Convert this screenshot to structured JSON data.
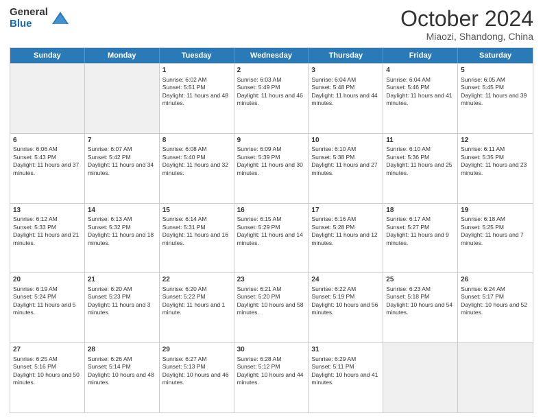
{
  "header": {
    "logo": {
      "general": "General",
      "blue": "Blue"
    },
    "title": "October 2024",
    "subtitle": "Miaozi, Shandong, China"
  },
  "weekdays": [
    "Sunday",
    "Monday",
    "Tuesday",
    "Wednesday",
    "Thursday",
    "Friday",
    "Saturday"
  ],
  "weeks": [
    [
      {
        "day": "",
        "empty": true
      },
      {
        "day": "",
        "empty": true
      },
      {
        "day": "1",
        "sunrise": "Sunrise: 6:02 AM",
        "sunset": "Sunset: 5:51 PM",
        "daylight": "Daylight: 11 hours and 48 minutes."
      },
      {
        "day": "2",
        "sunrise": "Sunrise: 6:03 AM",
        "sunset": "Sunset: 5:49 PM",
        "daylight": "Daylight: 11 hours and 46 minutes."
      },
      {
        "day": "3",
        "sunrise": "Sunrise: 6:04 AM",
        "sunset": "Sunset: 5:48 PM",
        "daylight": "Daylight: 11 hours and 44 minutes."
      },
      {
        "day": "4",
        "sunrise": "Sunrise: 6:04 AM",
        "sunset": "Sunset: 5:46 PM",
        "daylight": "Daylight: 11 hours and 41 minutes."
      },
      {
        "day": "5",
        "sunrise": "Sunrise: 6:05 AM",
        "sunset": "Sunset: 5:45 PM",
        "daylight": "Daylight: 11 hours and 39 minutes."
      }
    ],
    [
      {
        "day": "6",
        "sunrise": "Sunrise: 6:06 AM",
        "sunset": "Sunset: 5:43 PM",
        "daylight": "Daylight: 11 hours and 37 minutes."
      },
      {
        "day": "7",
        "sunrise": "Sunrise: 6:07 AM",
        "sunset": "Sunset: 5:42 PM",
        "daylight": "Daylight: 11 hours and 34 minutes."
      },
      {
        "day": "8",
        "sunrise": "Sunrise: 6:08 AM",
        "sunset": "Sunset: 5:40 PM",
        "daylight": "Daylight: 11 hours and 32 minutes."
      },
      {
        "day": "9",
        "sunrise": "Sunrise: 6:09 AM",
        "sunset": "Sunset: 5:39 PM",
        "daylight": "Daylight: 11 hours and 30 minutes."
      },
      {
        "day": "10",
        "sunrise": "Sunrise: 6:10 AM",
        "sunset": "Sunset: 5:38 PM",
        "daylight": "Daylight: 11 hours and 27 minutes."
      },
      {
        "day": "11",
        "sunrise": "Sunrise: 6:10 AM",
        "sunset": "Sunset: 5:36 PM",
        "daylight": "Daylight: 11 hours and 25 minutes."
      },
      {
        "day": "12",
        "sunrise": "Sunrise: 6:11 AM",
        "sunset": "Sunset: 5:35 PM",
        "daylight": "Daylight: 11 hours and 23 minutes."
      }
    ],
    [
      {
        "day": "13",
        "sunrise": "Sunrise: 6:12 AM",
        "sunset": "Sunset: 5:33 PM",
        "daylight": "Daylight: 11 hours and 21 minutes."
      },
      {
        "day": "14",
        "sunrise": "Sunrise: 6:13 AM",
        "sunset": "Sunset: 5:32 PM",
        "daylight": "Daylight: 11 hours and 18 minutes."
      },
      {
        "day": "15",
        "sunrise": "Sunrise: 6:14 AM",
        "sunset": "Sunset: 5:31 PM",
        "daylight": "Daylight: 11 hours and 16 minutes."
      },
      {
        "day": "16",
        "sunrise": "Sunrise: 6:15 AM",
        "sunset": "Sunset: 5:29 PM",
        "daylight": "Daylight: 11 hours and 14 minutes."
      },
      {
        "day": "17",
        "sunrise": "Sunrise: 6:16 AM",
        "sunset": "Sunset: 5:28 PM",
        "daylight": "Daylight: 11 hours and 12 minutes."
      },
      {
        "day": "18",
        "sunrise": "Sunrise: 6:17 AM",
        "sunset": "Sunset: 5:27 PM",
        "daylight": "Daylight: 11 hours and 9 minutes."
      },
      {
        "day": "19",
        "sunrise": "Sunrise: 6:18 AM",
        "sunset": "Sunset: 5:25 PM",
        "daylight": "Daylight: 11 hours and 7 minutes."
      }
    ],
    [
      {
        "day": "20",
        "sunrise": "Sunrise: 6:19 AM",
        "sunset": "Sunset: 5:24 PM",
        "daylight": "Daylight: 11 hours and 5 minutes."
      },
      {
        "day": "21",
        "sunrise": "Sunrise: 6:20 AM",
        "sunset": "Sunset: 5:23 PM",
        "daylight": "Daylight: 11 hours and 3 minutes."
      },
      {
        "day": "22",
        "sunrise": "Sunrise: 6:20 AM",
        "sunset": "Sunset: 5:22 PM",
        "daylight": "Daylight: 11 hours and 1 minute."
      },
      {
        "day": "23",
        "sunrise": "Sunrise: 6:21 AM",
        "sunset": "Sunset: 5:20 PM",
        "daylight": "Daylight: 10 hours and 58 minutes."
      },
      {
        "day": "24",
        "sunrise": "Sunrise: 6:22 AM",
        "sunset": "Sunset: 5:19 PM",
        "daylight": "Daylight: 10 hours and 56 minutes."
      },
      {
        "day": "25",
        "sunrise": "Sunrise: 6:23 AM",
        "sunset": "Sunset: 5:18 PM",
        "daylight": "Daylight: 10 hours and 54 minutes."
      },
      {
        "day": "26",
        "sunrise": "Sunrise: 6:24 AM",
        "sunset": "Sunset: 5:17 PM",
        "daylight": "Daylight: 10 hours and 52 minutes."
      }
    ],
    [
      {
        "day": "27",
        "sunrise": "Sunrise: 6:25 AM",
        "sunset": "Sunset: 5:16 PM",
        "daylight": "Daylight: 10 hours and 50 minutes."
      },
      {
        "day": "28",
        "sunrise": "Sunrise: 6:26 AM",
        "sunset": "Sunset: 5:14 PM",
        "daylight": "Daylight: 10 hours and 48 minutes."
      },
      {
        "day": "29",
        "sunrise": "Sunrise: 6:27 AM",
        "sunset": "Sunset: 5:13 PM",
        "daylight": "Daylight: 10 hours and 46 minutes."
      },
      {
        "day": "30",
        "sunrise": "Sunrise: 6:28 AM",
        "sunset": "Sunset: 5:12 PM",
        "daylight": "Daylight: 10 hours and 44 minutes."
      },
      {
        "day": "31",
        "sunrise": "Sunrise: 6:29 AM",
        "sunset": "Sunset: 5:11 PM",
        "daylight": "Daylight: 10 hours and 41 minutes."
      },
      {
        "day": "",
        "empty": true
      },
      {
        "day": "",
        "empty": true
      }
    ]
  ]
}
